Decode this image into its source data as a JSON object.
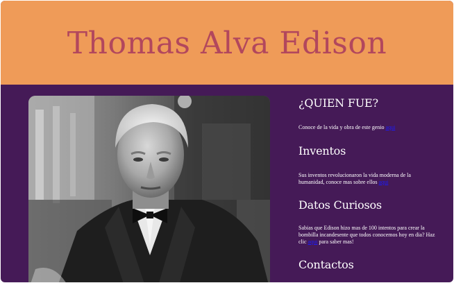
{
  "header": {
    "title": "Thomas Alva Edison"
  },
  "photo": {
    "alt": "Thomas Alva Edison"
  },
  "sections": [
    {
      "heading": "¿QUIEN FUE?",
      "text": "Conoce de la vida y obra de este genio",
      "link_label": "aqui"
    },
    {
      "heading": "Inventos",
      "text": "Sus inventos revolucionaron la vida moderna de la humanidad, conoce mas sobre ellos",
      "link_label": "aqui"
    },
    {
      "heading": "Datos Curiosos",
      "text": "Sabias que Edison hizo mas de 100 intentos para crear la bombilla incandesente que todos conocemos hoy en dia? Haz clic",
      "link_label": "aqui",
      "text_after": "para saber mas!"
    },
    {
      "heading": "Contactos"
    }
  ],
  "colors": {
    "header_bg": "#ef9b58",
    "title": "#b2475d",
    "body_bg": "#451a57",
    "link": "#1a1aff"
  }
}
